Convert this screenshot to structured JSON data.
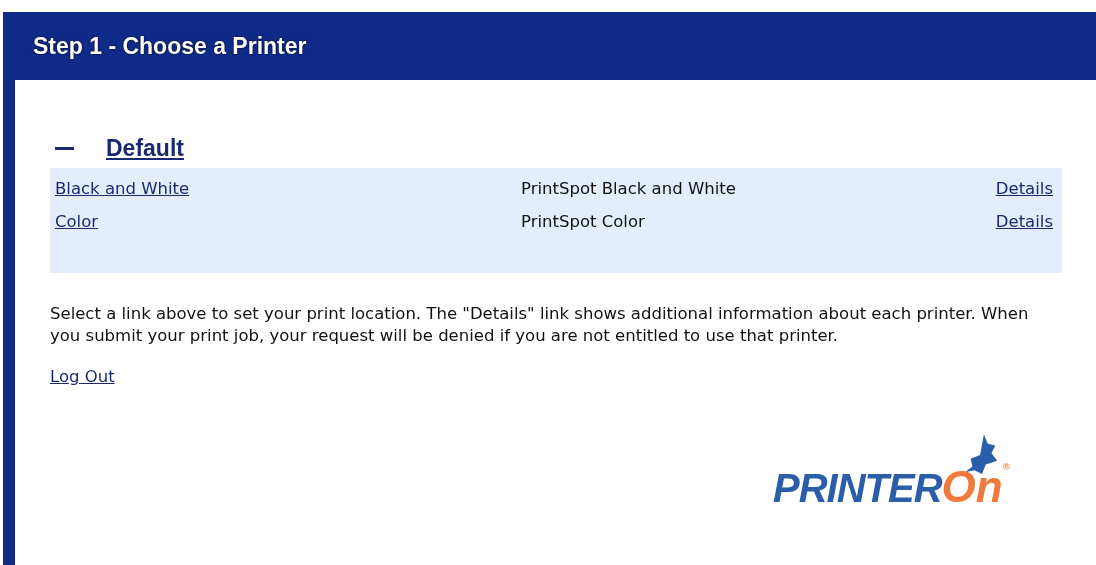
{
  "header": {
    "title": "Step 1 - Choose a Printer"
  },
  "group": {
    "name": "Default",
    "expanded": true,
    "printers": [
      {
        "name": "Black and White",
        "description": "PrintSpot Black and White",
        "details": "Details"
      },
      {
        "name": "Color",
        "description": "PrintSpot Color",
        "details": "Details"
      }
    ]
  },
  "instructions": "Select a link above to set your print location. The \"Details\" link shows additional information about each printer. When you submit your print job, your request will be denied if you are not entitled to use that printer.",
  "logout": "Log Out",
  "logo": {
    "word_main": "PRINTER",
    "word_accent": "On",
    "registered": "®"
  }
}
